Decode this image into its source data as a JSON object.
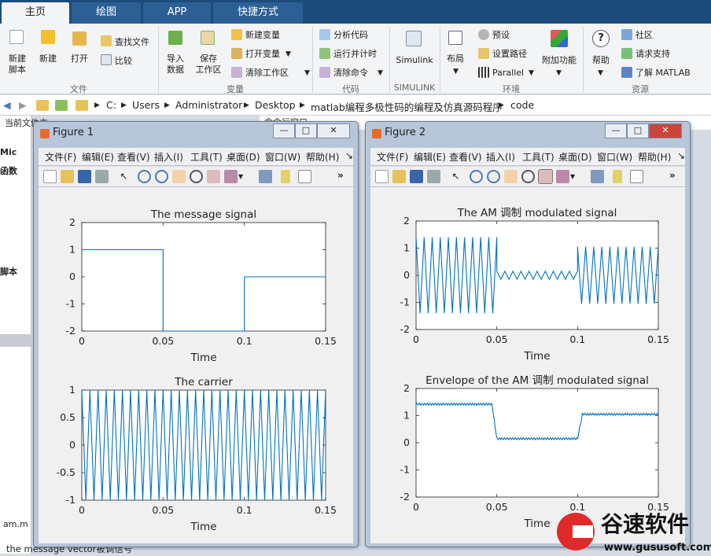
{
  "tabs": [
    "主页",
    "绘图",
    "APP",
    "快捷方式"
  ],
  "ribbon": {
    "new_script": "新建\n脚本",
    "new": "新建",
    "open": "打开",
    "find_files": "查找文件",
    "compare": "比较",
    "group_file": "文件",
    "import": "导入\n数据",
    "save_ws": "保存\n工作区",
    "new_var": "新建变量",
    "open_var": "打开变量",
    "clear_ws": "清除工作区",
    "group_var": "变量",
    "analyze": "分析代码",
    "run_time": "运行并计时",
    "clear_cmd": "清除命令",
    "group_code": "代码",
    "simulink": "Simulink",
    "group_simulink": "SIMULINK",
    "layout": "布局",
    "prefs": "预设",
    "set_path": "设置路径",
    "parallel": "Parallel",
    "addons": "附加功能",
    "group_env": "环境",
    "help": "帮助",
    "community": "社区",
    "support": "请求支持",
    "learn": "了解 MATLAB",
    "group_res": "资源"
  },
  "address": [
    "C:",
    "Users",
    "Administrator",
    "Desktop",
    "matlab编程多极性码的编程及仿真源码程序",
    "code"
  ],
  "left_panel": {
    "current_folder": "当前文件夹",
    "mic": "Mic",
    "func": "函数",
    "script": "脚本",
    "file": "am.m",
    "bottom_text": "the message vector被调信号",
    "cmd_window": "命令行窗口"
  },
  "figure1": {
    "title": "Figure 1",
    "menu": [
      "文件(F)",
      "编辑(E)",
      "查看(V)",
      "插入(I)",
      "工具(T)",
      "桌面(D)",
      "窗口(W)",
      "帮助(H)"
    ],
    "plot1": {
      "title": "The message signal",
      "xlabel": "Time",
      "xticks": [
        "0",
        "0.05",
        "0.1",
        "0.15"
      ],
      "yticks": [
        "2",
        "1",
        "0",
        "-1",
        "-2"
      ]
    },
    "plot2": {
      "title": "The carrier",
      "xlabel": "Time",
      "xticks": [
        "0",
        "0.05",
        "0.1",
        "0.15"
      ],
      "yticks": [
        "1",
        "0.5",
        "0",
        "-0.5",
        "-1"
      ]
    }
  },
  "figure2": {
    "title": "Figure 2",
    "menu": [
      "文件(F)",
      "编辑(E)",
      "查看(V)",
      "插入(I)",
      "工具(T)",
      "桌面(D)",
      "窗口(W)",
      "帮助(H)"
    ],
    "plot1": {
      "title": "The AM 调制  modulated signal",
      "xlabel": "Time",
      "xticks": [
        "0",
        "0.05",
        "0.1",
        "0.15"
      ],
      "yticks": [
        "2",
        "1",
        "0",
        "-1",
        "-2"
      ]
    },
    "plot2": {
      "title": "Envelope of the AM 调制 modulated signal",
      "xlabel": "Time",
      "xticks": [
        "0",
        "0.05",
        "0.1",
        "0.15"
      ],
      "yticks": [
        "2",
        "1",
        "0",
        "-1",
        "-2"
      ]
    }
  },
  "watermark": {
    "name": "谷速软件",
    "url": "www.gususoft.com"
  },
  "chart_data": [
    {
      "type": "line",
      "title": "The message signal",
      "xlabel": "Time",
      "xlim": [
        0,
        0.15
      ],
      "ylim": [
        -2,
        2
      ],
      "x": [
        0,
        0.05,
        0.05,
        0.1,
        0.1,
        0.15
      ],
      "y": [
        1,
        1,
        -2,
        -2,
        0,
        0
      ]
    },
    {
      "type": "line",
      "title": "The carrier",
      "xlabel": "Time",
      "xlim": [
        0,
        0.15
      ],
      "ylim": [
        -1,
        1
      ],
      "carrier_cycles": 30,
      "amplitude": 1
    },
    {
      "type": "line",
      "title": "The AM 调制  modulated signal",
      "xlabel": "Time",
      "xlim": [
        0,
        0.15
      ],
      "ylim": [
        -2,
        2
      ],
      "segments": [
        {
          "x0": 0,
          "x1": 0.05,
          "amplitude": 1.4
        },
        {
          "x0": 0.05,
          "x1": 0.1,
          "amplitude": 0.15
        },
        {
          "x0": 0.1,
          "x1": 0.15,
          "amplitude": 1.05
        }
      ]
    },
    {
      "type": "line",
      "title": "Envelope of the AM 调制 modulated signal",
      "xlabel": "Time",
      "xlim": [
        0,
        0.15
      ],
      "ylim": [
        -2,
        2
      ],
      "x": [
        0,
        0.047,
        0.05,
        0.1,
        0.103,
        0.15
      ],
      "y": [
        1.42,
        1.42,
        0.15,
        0.15,
        1.05,
        1.05
      ]
    }
  ]
}
